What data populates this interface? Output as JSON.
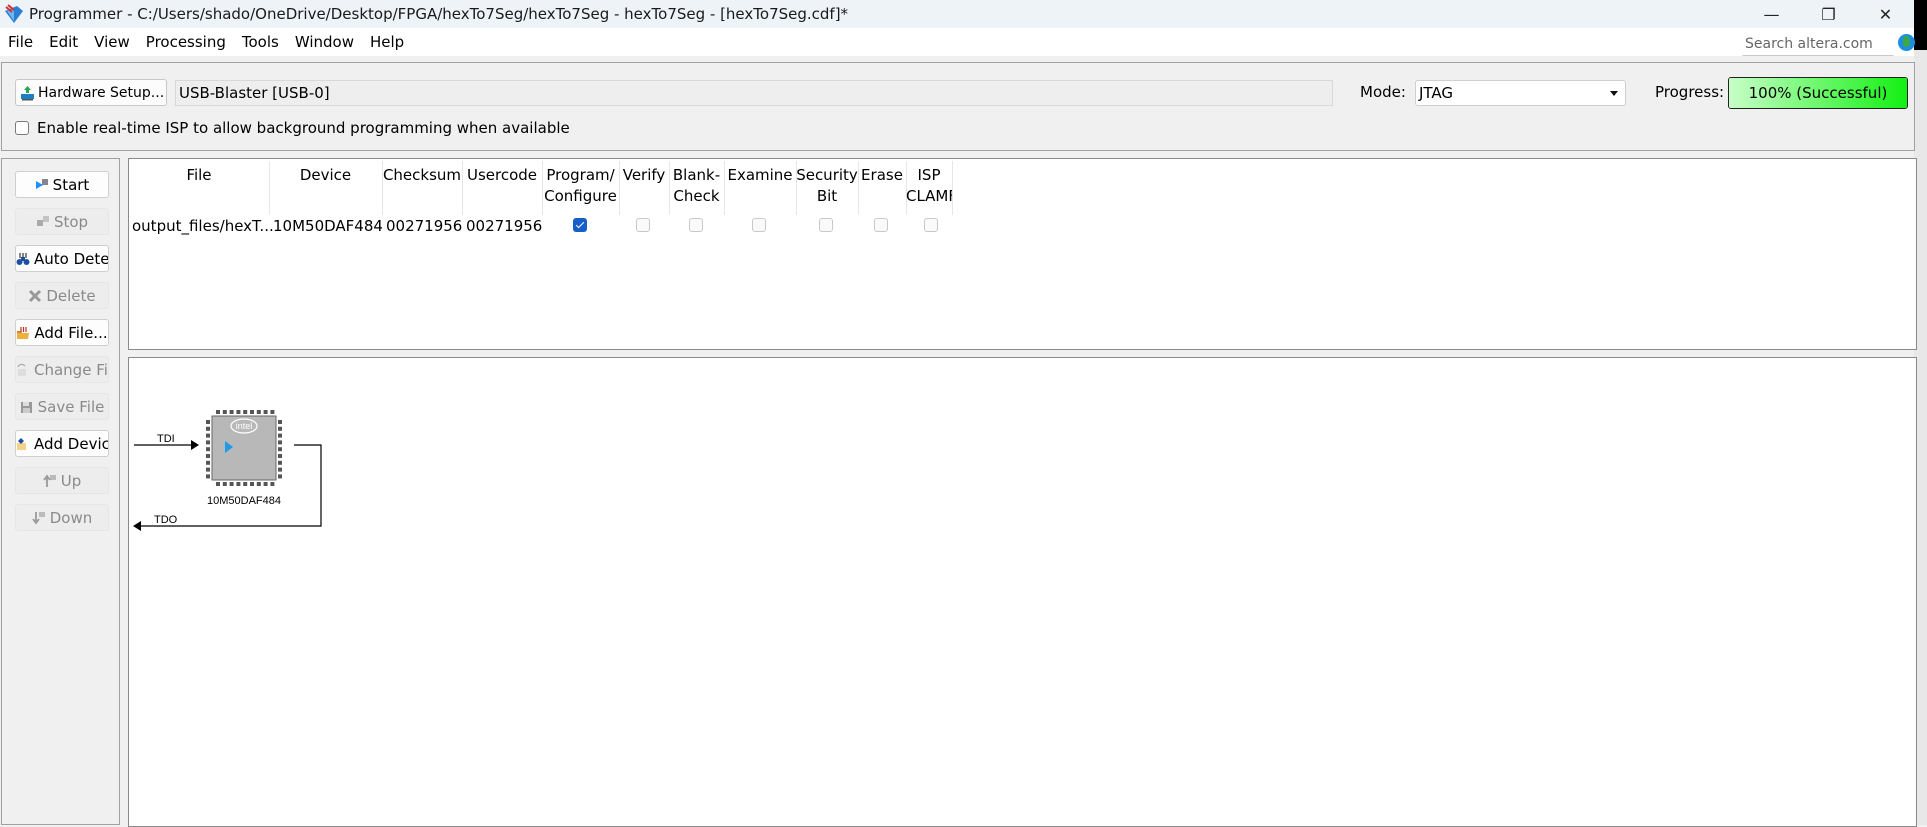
{
  "window": {
    "title": "Programmer - C:/Users/shado/OneDrive/Desktop/FPGA/hexTo7Seg/hexTo7Seg - hexTo7Seg - [hexTo7Seg.cdf]*",
    "minimize": "—",
    "restore": "❐",
    "close": "✕"
  },
  "menu": {
    "items": [
      "File",
      "Edit",
      "View",
      "Processing",
      "Tools",
      "Window",
      "Help"
    ],
    "search_placeholder": "Search altera.com"
  },
  "hardware": {
    "setup_label": "Hardware Setup...",
    "current": "USB-Blaster [USB-0]",
    "mode_label": "Mode:",
    "mode_value": "JTAG",
    "progress_label": "Progress:",
    "progress_value": 100,
    "progress_text": "100% (Successful)",
    "isp_checkbox_label": "Enable real-time ISP to allow background programming when available",
    "isp_checked": false
  },
  "sidebar": {
    "buttons": [
      {
        "label": "Start",
        "icon": "start-icon",
        "enabled": true
      },
      {
        "label": "Stop",
        "icon": "stop-icon",
        "enabled": false
      },
      {
        "label": "Auto Detec",
        "icon": "auto-detect-icon",
        "enabled": true
      },
      {
        "label": "Delete",
        "icon": "delete-icon",
        "enabled": false
      },
      {
        "label": "Add File...",
        "icon": "add-file-icon",
        "enabled": true
      },
      {
        "label": "Change File",
        "icon": "change-file-icon",
        "enabled": false
      },
      {
        "label": "Save File",
        "icon": "save-file-icon",
        "enabled": false
      },
      {
        "label": "Add Device",
        "icon": "add-device-icon",
        "enabled": true
      },
      {
        "label": "Up",
        "icon": "up-icon",
        "enabled": false
      },
      {
        "label": "Down",
        "icon": "down-icon",
        "enabled": false
      }
    ]
  },
  "table": {
    "headers": [
      "File",
      "Device",
      "Checksum",
      "Usercode",
      "Program/\nConfigure",
      "Verify",
      "Blank-\nCheck",
      "Examine",
      "Security\nBit",
      "Erase",
      "ISP\nCLAMP"
    ],
    "header_lines": [
      [
        "File"
      ],
      [
        "Device"
      ],
      [
        "Checksum"
      ],
      [
        "Usercode"
      ],
      [
        "Program/",
        "Configure"
      ],
      [
        "Verify"
      ],
      [
        "Blank-",
        "Check"
      ],
      [
        "Examine"
      ],
      [
        "Security",
        "Bit"
      ],
      [
        "Erase"
      ],
      [
        "ISP",
        "CLAMF"
      ]
    ],
    "rows": [
      {
        "file": "output_files/hexT...",
        "device": "10M50DAF484",
        "checksum": "00271956",
        "usercode": "00271956",
        "program_configure": true,
        "verify": false,
        "blank_check": false,
        "examine": false,
        "security_bit": false,
        "erase": false,
        "isp_clamp": false
      }
    ]
  },
  "chain": {
    "tdi_label": "TDI",
    "tdo_label": "TDO",
    "device_label": "10M50DAF484",
    "chip_logo": "intel"
  },
  "colors": {
    "progress_start": "#c8ffc8",
    "progress_end": "#12f012",
    "checkbox_checked": "#1560c8",
    "chip_body": "#b8b8b8"
  }
}
